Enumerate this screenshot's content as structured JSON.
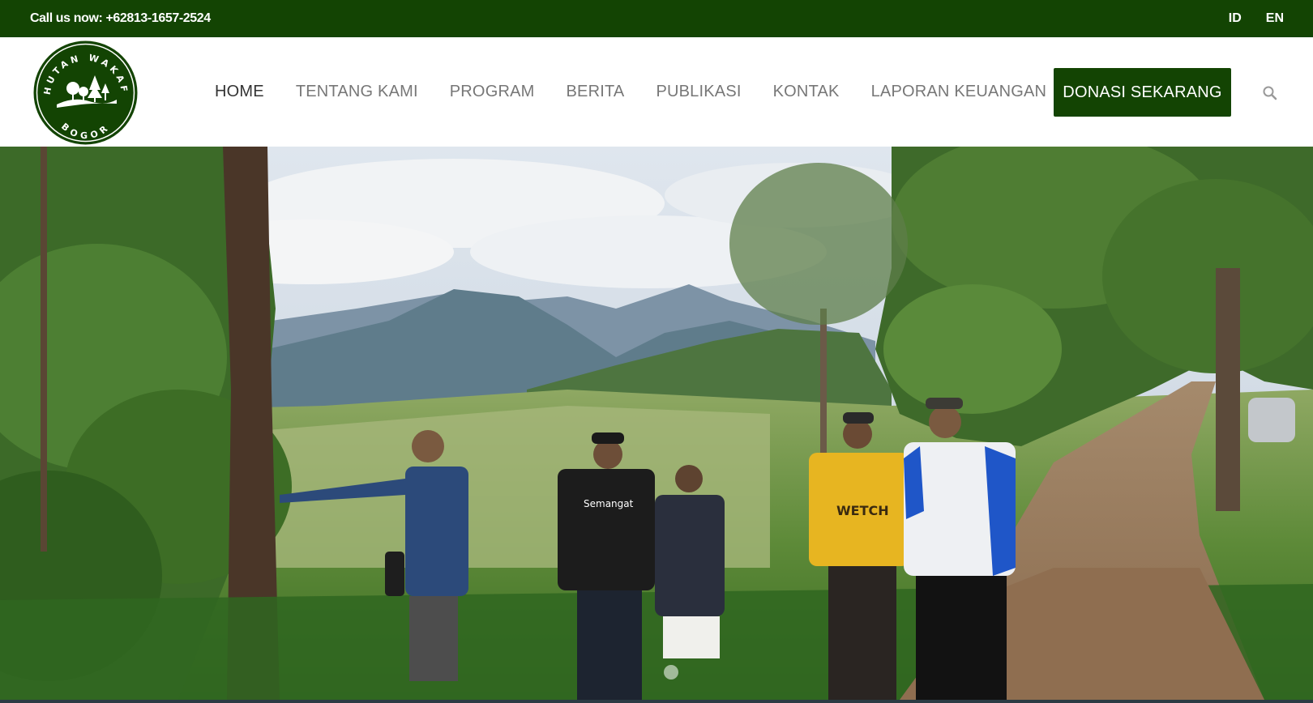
{
  "topbar": {
    "phone_text": "Call us now: +62813-1657-2524",
    "languages": [
      "ID",
      "EN"
    ]
  },
  "logo": {
    "text_top": "HUTAN WAKAF",
    "text_bottom": "BOGOR"
  },
  "nav": {
    "items": [
      {
        "label": "HOME",
        "active": true
      },
      {
        "label": "TENTANG KAMI",
        "active": false
      },
      {
        "label": "PROGRAM",
        "active": false
      },
      {
        "label": "BERITA",
        "active": false
      },
      {
        "label": "PUBLIKASI",
        "active": false
      },
      {
        "label": "KONTAK",
        "active": false
      },
      {
        "label": "LAPORAN KEUANGAN",
        "active": false
      }
    ],
    "donate_label": "DONASI SEKARANG",
    "search_icon": "search-icon"
  },
  "hero": {
    "shirt_text_1": "Semangat",
    "shirt_text_2": "WETCH"
  },
  "colors": {
    "brand_green": "#134403",
    "nav_text": "#777777",
    "nav_active": "#333333"
  }
}
